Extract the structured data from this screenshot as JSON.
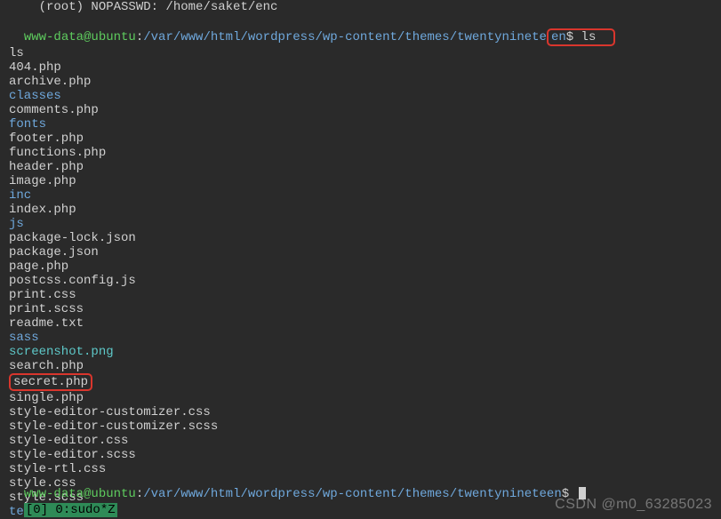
{
  "lines": {
    "sudoers": "    (root) NOPASSWD: /home/saket/enc",
    "prompt1_user": "www-data@ubuntu",
    "prompt1_colon": ":",
    "prompt1_path": "/var/www/html/wordpress/wp-content/themes/twentyninete",
    "prompt1_path_tail": "en",
    "prompt1_dollar": "$",
    "prompt1_cmd": " ls",
    "cmd_echo": "ls",
    "files": [
      {
        "name": "404.php",
        "cls": "normal"
      },
      {
        "name": "archive.php",
        "cls": "normal"
      },
      {
        "name": "classes",
        "cls": "blue"
      },
      {
        "name": "comments.php",
        "cls": "normal"
      },
      {
        "name": "fonts",
        "cls": "blue"
      },
      {
        "name": "footer.php",
        "cls": "normal"
      },
      {
        "name": "functions.php",
        "cls": "normal"
      },
      {
        "name": "header.php",
        "cls": "normal"
      },
      {
        "name": "image.php",
        "cls": "normal"
      },
      {
        "name": "inc",
        "cls": "blue"
      },
      {
        "name": "index.php",
        "cls": "normal"
      },
      {
        "name": "js",
        "cls": "blue"
      },
      {
        "name": "package-lock.json",
        "cls": "normal"
      },
      {
        "name": "package.json",
        "cls": "normal"
      },
      {
        "name": "page.php",
        "cls": "normal"
      },
      {
        "name": "postcss.config.js",
        "cls": "normal"
      },
      {
        "name": "print.css",
        "cls": "normal"
      },
      {
        "name": "print.scss",
        "cls": "normal"
      },
      {
        "name": "readme.txt",
        "cls": "normal"
      },
      {
        "name": "sass",
        "cls": "blue"
      },
      {
        "name": "screenshot.png",
        "cls": "cyan"
      },
      {
        "name": "search.php",
        "cls": "normal"
      },
      {
        "name": "secret.php",
        "cls": "normal",
        "boxed": true
      },
      {
        "name": "single.php",
        "cls": "normal"
      },
      {
        "name": "style-editor-customizer.css",
        "cls": "normal"
      },
      {
        "name": "style-editor-customizer.scss",
        "cls": "normal"
      },
      {
        "name": "style-editor.css",
        "cls": "normal"
      },
      {
        "name": "style-editor.scss",
        "cls": "normal"
      },
      {
        "name": "style-rtl.css",
        "cls": "normal"
      },
      {
        "name": "style.css",
        "cls": "normal"
      },
      {
        "name": "style.scss",
        "cls": "normal"
      },
      {
        "name": "template-parts",
        "cls": "blue"
      }
    ],
    "prompt2_user": "www-data@ubuntu",
    "prompt2_colon": ":",
    "prompt2_path": "/var/www/html/wordpress/wp-content/themes/twentynineteen",
    "prompt2_dollar": "$",
    "statusbar": "[0] 0:sudo*Z",
    "watermark": "CSDN @m0_63285023"
  }
}
